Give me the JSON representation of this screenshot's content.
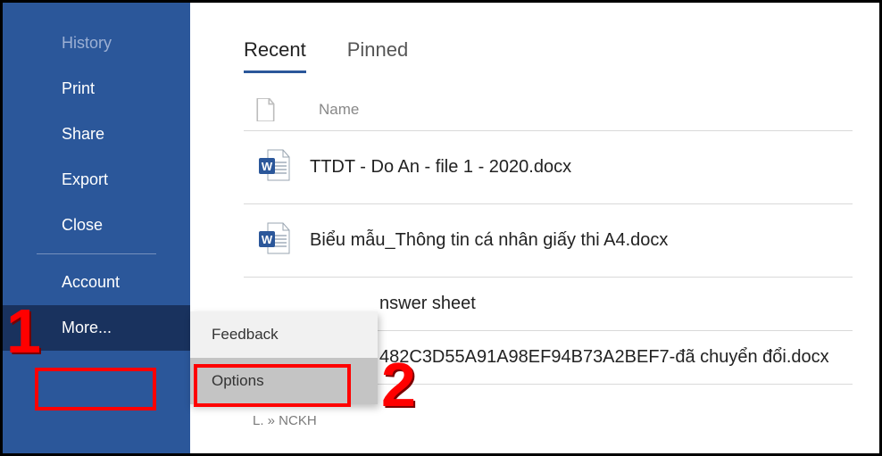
{
  "sidebar": {
    "items": [
      {
        "label": "History",
        "dim": true
      },
      {
        "label": "Print",
        "dim": false
      },
      {
        "label": "Share",
        "dim": false
      },
      {
        "label": "Export",
        "dim": false
      },
      {
        "label": "Close",
        "dim": false
      }
    ],
    "account_label": "Account",
    "more_label": "More..."
  },
  "flyout": {
    "feedback_label": "Feedback",
    "options_label": "Options"
  },
  "main": {
    "tabs": {
      "recent": "Recent",
      "pinned": "Pinned"
    },
    "columns": {
      "name": "Name"
    },
    "files": [
      {
        "name": "TTDT - Do An - file 1 - 2020.docx"
      },
      {
        "name": "Biểu mẫu_Thông tin cá nhân giấy thi A4.docx"
      },
      {
        "name": "nswer sheet"
      },
      {
        "name": "482C3D55A91A98EF94B73A2BEF7-đã chuyển đổi.docx"
      }
    ],
    "partial_sub": "L. » NCKH"
  },
  "callouts": {
    "one": "1",
    "two": "2"
  }
}
